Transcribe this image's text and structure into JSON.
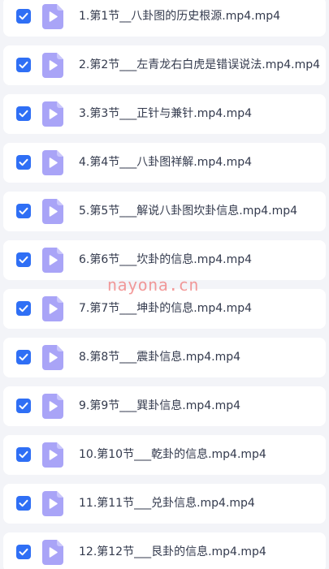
{
  "files": [
    {
      "name": "1.第1节__八卦图的历史根源.mp4.mp4",
      "checked": true,
      "icon": "video-file-icon"
    },
    {
      "name": "2.第2节___左青龙右白虎是错误说法.mp4.mp4",
      "checked": true,
      "icon": "video-file-icon"
    },
    {
      "name": "3.第3节___正针与兼针.mp4.mp4",
      "checked": true,
      "icon": "video-file-icon"
    },
    {
      "name": "4.第4节___八卦图祥解.mp4.mp4",
      "checked": true,
      "icon": "video-file-icon"
    },
    {
      "name": "5.第5节___解说八卦图坎卦信息.mp4.mp4",
      "checked": true,
      "icon": "video-file-icon"
    },
    {
      "name": "6.第6节___坎卦的信息.mp4.mp4",
      "checked": true,
      "icon": "video-file-icon"
    },
    {
      "name": "7.第7节___坤卦的信息.mp4.mp4",
      "checked": true,
      "icon": "video-file-icon"
    },
    {
      "name": "8.第8节___震卦信息.mp4.mp4",
      "checked": true,
      "icon": "video-file-icon"
    },
    {
      "name": "9.第9节___巽卦信息.mp4.mp4",
      "checked": true,
      "icon": "video-file-icon"
    },
    {
      "name": "10.第10节___乾卦的信息.mp4.mp4",
      "checked": true,
      "icon": "video-file-icon"
    },
    {
      "name": "11.第11节___兑卦信息.mp4.mp4",
      "checked": true,
      "icon": "video-file-icon"
    },
    {
      "name": "12.第12节___艮卦的信息.mp4.mp4",
      "checked": true,
      "icon": "video-file-icon"
    }
  ],
  "watermark": "nayona.cn",
  "colors": {
    "checkbox": "#2f6ff5",
    "file_icon": "#a9a4f7",
    "background": "#f3f4f8",
    "row": "#ffffff",
    "text": "#333a4d",
    "watermark": "#f07a7a"
  }
}
